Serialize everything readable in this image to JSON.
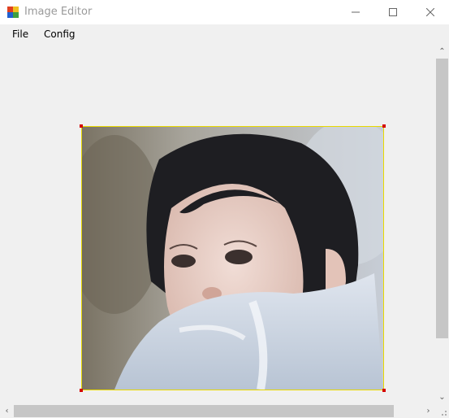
{
  "window": {
    "title": "Image Editor",
    "icon": "app-icon",
    "controls": [
      "minimize-icon",
      "maximize-icon",
      "close-icon"
    ]
  },
  "menu": {
    "items": [
      {
        "label": "File"
      },
      {
        "label": "Config"
      }
    ]
  },
  "editor": {
    "image": "portrait photo of a young woman with dark hair wearing a light blue scarf",
    "selection_color": "#e8d800",
    "handle_color": "#d40000"
  },
  "scrollbars": {
    "vertical_arrows": [
      "chevron-up-icon",
      "chevron-down-icon"
    ],
    "horizontal_arrows": [
      "chevron-left-icon",
      "chevron-right-icon"
    ]
  }
}
